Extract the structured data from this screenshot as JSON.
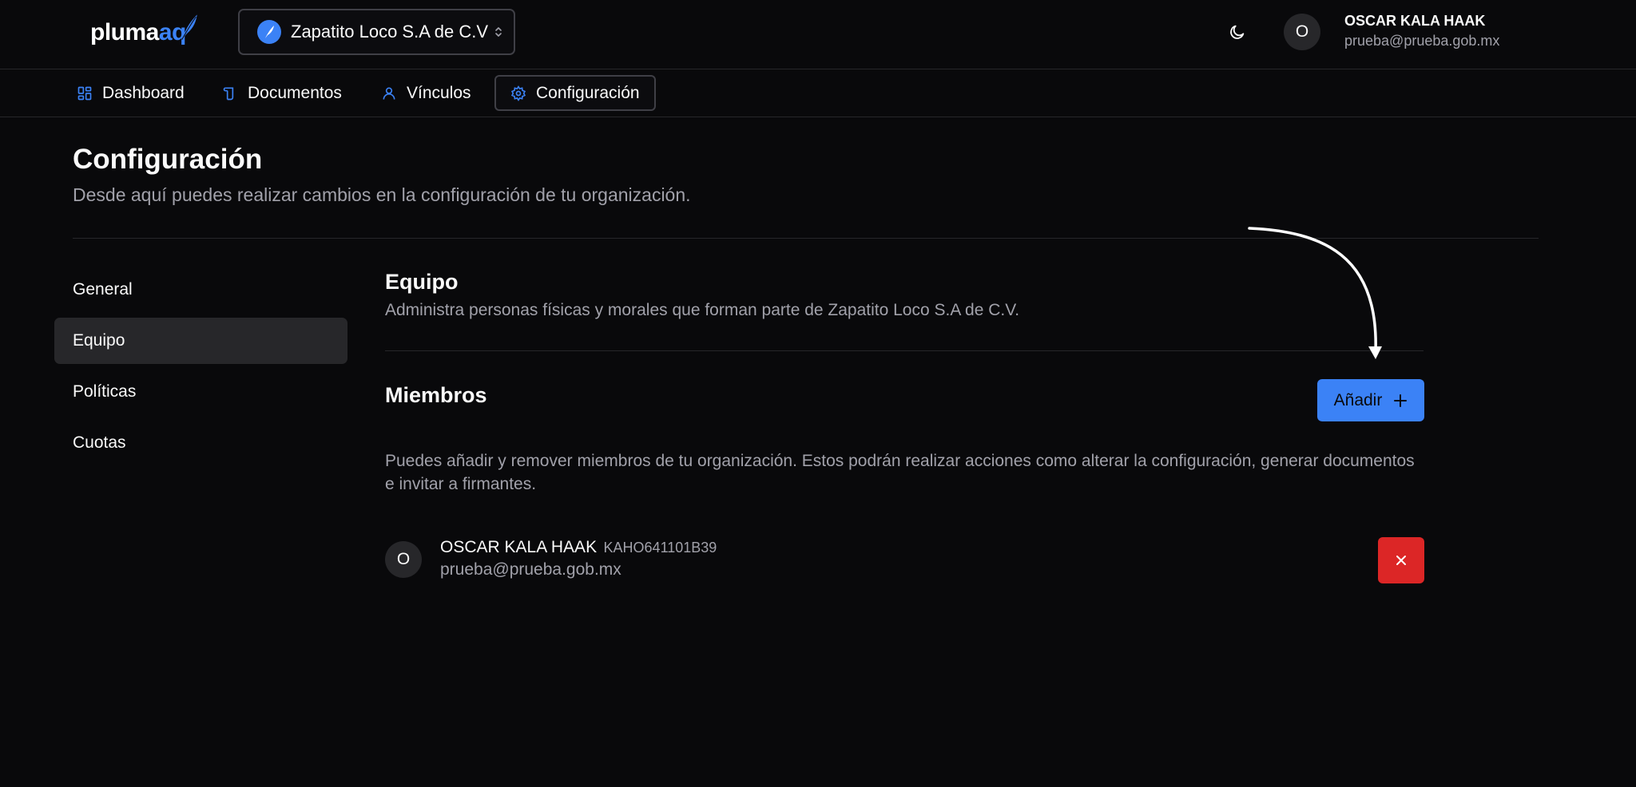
{
  "header": {
    "logo_text_main": "pluma",
    "logo_text_accent": "aq",
    "org_name": "Zapatito Loco S.A de C.V",
    "user_initial": "O",
    "user_name": "OSCAR KALA HAAK",
    "user_email": "prueba@prueba.gob.mx"
  },
  "nav": {
    "items": [
      {
        "label": "Dashboard",
        "icon": "dashboard-icon"
      },
      {
        "label": "Documentos",
        "icon": "documents-icon"
      },
      {
        "label": "Vínculos",
        "icon": "user-icon"
      },
      {
        "label": "Configuración",
        "icon": "gear-icon",
        "active": true
      }
    ]
  },
  "page": {
    "title": "Configuración",
    "subtitle": "Desde aquí puedes realizar cambios en la configuración de tu organización."
  },
  "sidebar": {
    "items": [
      {
        "label": "General"
      },
      {
        "label": "Equipo",
        "active": true
      },
      {
        "label": "Políticas"
      },
      {
        "label": "Cuotas"
      }
    ]
  },
  "section": {
    "title": "Equipo",
    "subtitle": "Administra personas físicas y morales que forman parte de Zapatito Loco S.A de C.V."
  },
  "members": {
    "title": "Miembros",
    "add_label": "Añadir",
    "description": "Puedes añadir y remover miembros de tu organización. Estos podrán realizar acciones como alterar la configuración, generar documentos e invitar a firmantes.",
    "list": [
      {
        "initial": "O",
        "name": "OSCAR KALA HAAK",
        "rfc": "KAHO641101B39",
        "email": "prueba@prueba.gob.mx"
      }
    ]
  },
  "colors": {
    "background": "#09090b",
    "accent": "#3b82f6",
    "danger": "#dc2626",
    "muted_text": "#a1a1aa",
    "border": "#27272a"
  }
}
